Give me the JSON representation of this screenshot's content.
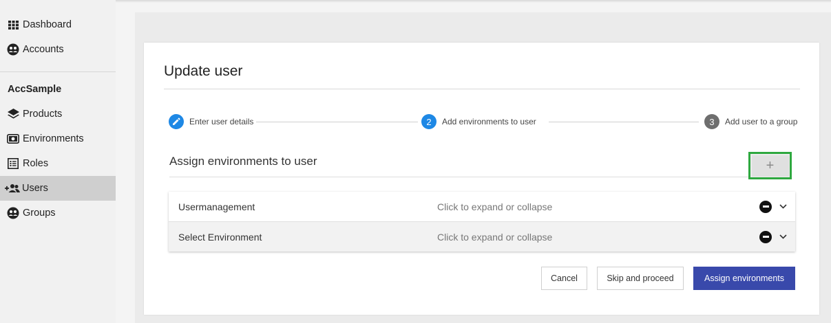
{
  "sidebar": {
    "items": [
      {
        "label": "Dashboard",
        "icon": "grid-icon"
      },
      {
        "label": "Accounts",
        "icon": "users-circle-icon"
      }
    ],
    "section_label": "AccSample",
    "section_items": [
      {
        "label": "Products",
        "icon": "layers-icon"
      },
      {
        "label": "Environments",
        "icon": "camera-icon"
      },
      {
        "label": "Roles",
        "icon": "list-icon"
      },
      {
        "label": "Users",
        "icon": "add-users-icon",
        "active": true
      },
      {
        "label": "Groups",
        "icon": "users-circle-icon"
      }
    ]
  },
  "page": {
    "title": "Update user"
  },
  "stepper": {
    "steps": [
      {
        "label": "Enter user details",
        "state": "done",
        "marker": "edit"
      },
      {
        "label": "Add environments to user",
        "state": "active",
        "marker": "2"
      },
      {
        "label": "Add user to a group",
        "state": "pending",
        "marker": "3"
      }
    ]
  },
  "assign": {
    "title": "Assign environments to user",
    "add_label": "+",
    "rows": [
      {
        "title": "Usermanagement",
        "hint": "Click to expand or collapse"
      },
      {
        "title": "Select Environment",
        "hint": "Click to expand or collapse"
      }
    ]
  },
  "actions": {
    "cancel": "Cancel",
    "skip": "Skip and proceed",
    "assign": "Assign environments"
  },
  "colors": {
    "primary": "#3949ab",
    "step_active": "#1e88e5",
    "step_pending": "#6e6e6e",
    "highlight": "#2ea83f",
    "active_nav": "#cfcfcf"
  }
}
